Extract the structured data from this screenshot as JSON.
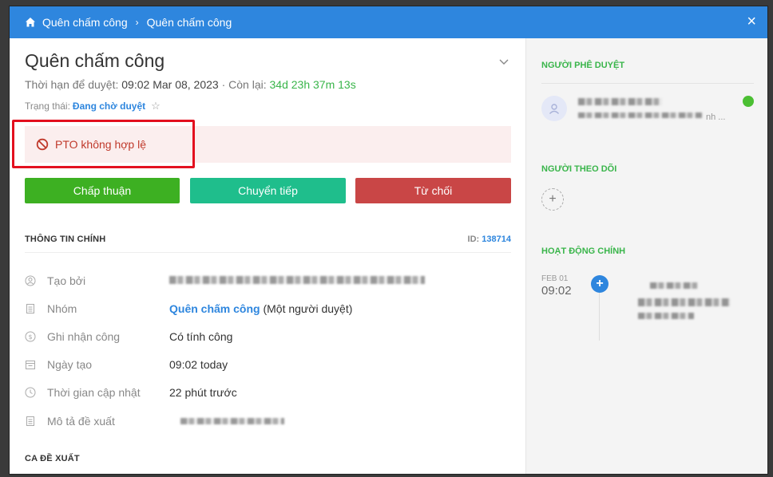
{
  "breadcrumb": [
    "Quên chấm công",
    "Quên chấm công"
  ],
  "title": "Quên chấm công",
  "deadline": {
    "label": "Thời hạn để duyệt:",
    "value": "09:02 Mar 08, 2023",
    "remain_label": "· Còn lại:",
    "remain": "34d 23h 37m 13s"
  },
  "status": {
    "label": "Trạng thái:",
    "value": "Đang chờ duyệt"
  },
  "alert": {
    "text": "PTO không hợp lệ"
  },
  "actions": {
    "approve": "Chấp thuận",
    "forward": "Chuyển tiếp",
    "reject": "Từ chối"
  },
  "main_info": {
    "heading": "THÔNG TIN CHÍNH",
    "id_label": "ID:",
    "id_value": "138714",
    "rows": [
      {
        "label": "Tạo bởi",
        "value": ""
      },
      {
        "label": "Nhóm",
        "value_link": "Quên chấm công",
        "value_suffix": " (Một người duyệt)"
      },
      {
        "label": "Ghi nhận công",
        "value": "Có tính công"
      },
      {
        "label": "Ngày tạo",
        "value": "09:02 today"
      },
      {
        "label": "Thời gian cập nhật",
        "value": "22 phút trước"
      },
      {
        "label": "Mô tả đề xuất",
        "value": ""
      }
    ]
  },
  "shift_heading": "CA ĐỀ XUẤT",
  "sidebar": {
    "approver_heading": "NGƯỜI PHÊ DUYỆT",
    "approver_sub": "nh ...",
    "follower_heading": "NGƯỜI THEO DÕI",
    "activity_heading": "HOẠT ĐỘNG CHÍNH",
    "activity": {
      "date": "FEB 01",
      "time": "09:02"
    }
  },
  "colors": {
    "topbar": "#2e86de",
    "approve": "#3db022",
    "forward": "#1fbe8c",
    "reject": "#c94646",
    "accent_green": "#39b54a"
  }
}
